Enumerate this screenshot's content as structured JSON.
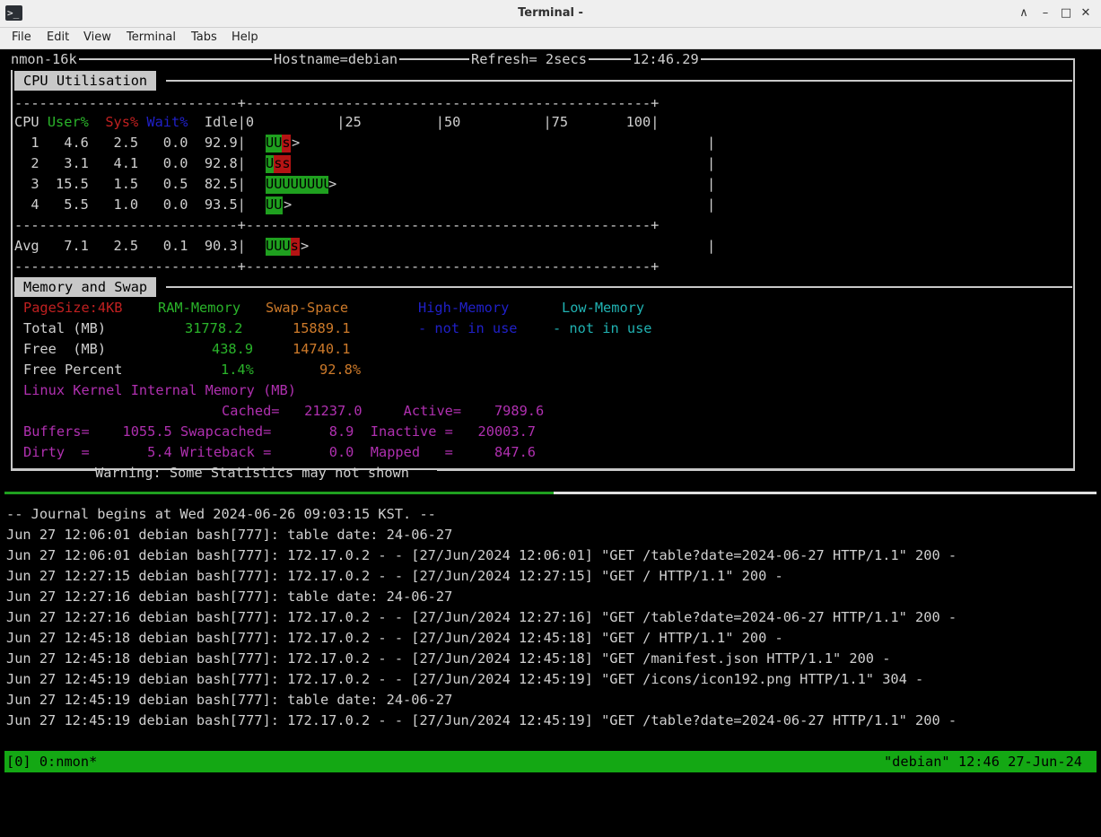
{
  "window": {
    "title": "Terminal -",
    "icon": "terminal-icon"
  },
  "menu": [
    "File",
    "Edit",
    "View",
    "Terminal",
    "Tabs",
    "Help"
  ],
  "nmon": {
    "header": {
      "name": "nmon-16k",
      "hostname": "Hostname=debian",
      "refresh": "Refresh= 2secs",
      "time": "12:46.29"
    },
    "cpu": {
      "section_title": "CPU Utilisation",
      "separator_top": "---------------------------+-------------------------------------------------+",
      "header_cpu": "CPU ",
      "header_user": "User%",
      "header_sys": "Sys%",
      "header_wait": "Wait%",
      "header_idle": "Idle",
      "scale": "|0          |25         |50          |75       100|",
      "rows": [
        {
          "line": "  1   4.6   2.5   0.0  92.9|",
          "bar": "UUs",
          "user": 4.6,
          "sys": 2.5
        },
        {
          "line": "  2   3.1   4.1   0.0  92.8|",
          "bar": "Uss",
          "user": 3.1,
          "sys": 4.1
        },
        {
          "line": "  3  15.5   1.5   0.5  82.5|",
          "bar": "UUUUUUUU",
          "user": 15.5,
          "sys": 1.5
        },
        {
          "line": "  4   5.5   1.0   0.0  93.5|",
          "bar": "UU",
          "user": 5.5,
          "sys": 1.0
        }
      ],
      "avg": {
        "line": "Avg   7.1   2.5   0.1  90.3|",
        "bar": "UUUs",
        "user": 7.1,
        "sys": 2.5
      },
      "bar_end": ">",
      "right_edge": "|"
    },
    "memory": {
      "section_title": "Memory and Swap",
      "pagesize": "PageSize:4KB",
      "ram_label": "RAM-Memory",
      "swap_label": "Swap-Space",
      "high_label": "High-Memory",
      "low_label": "Low-Memory",
      "total_label": "Total (MB)",
      "total_ram": "31778.2",
      "total_swap": "15889.1",
      "high_state": "- not in use",
      "low_state": "- not in use",
      "free_label": "Free  (MB)",
      "free_ram": "438.9",
      "free_swap": "14740.1",
      "freepct_label": "Free Percent",
      "freepct_ram": "1.4%",
      "freepct_swap": "92.8%",
      "kernel_title": "Linux Kernel Internal Memory (MB)",
      "kernel_line1": "                        Cached=   21237.0     Active=    7989.6",
      "kernel_line2": "Buffers=    1055.5 Swapcached=       8.9  Inactive =   20003.7",
      "kernel_line3": "Dirty  =       5.4 Writeback =       0.0  Mapped   =     847.6"
    },
    "warning": "Warning: Some Statistics may not shown"
  },
  "journal": [
    "-- Journal begins at Wed 2024-06-26 09:03:15 KST. --",
    "Jun 27 12:06:01 debian bash[777]: table date: 24-06-27",
    "Jun 27 12:06:01 debian bash[777]: 172.17.0.2 - - [27/Jun/2024 12:06:01] \"GET /table?date=2024-06-27 HTTP/1.1\" 200 -",
    "Jun 27 12:27:15 debian bash[777]: 172.17.0.2 - - [27/Jun/2024 12:27:15] \"GET / HTTP/1.1\" 200 -",
    "Jun 27 12:27:16 debian bash[777]: table date: 24-06-27",
    "Jun 27 12:27:16 debian bash[777]: 172.17.0.2 - - [27/Jun/2024 12:27:16] \"GET /table?date=2024-06-27 HTTP/1.1\" 200 -",
    "Jun 27 12:45:18 debian bash[777]: 172.17.0.2 - - [27/Jun/2024 12:45:18] \"GET / HTTP/1.1\" 200 -",
    "Jun 27 12:45:18 debian bash[777]: 172.17.0.2 - - [27/Jun/2024 12:45:18] \"GET /manifest.json HTTP/1.1\" 200 -",
    "Jun 27 12:45:19 debian bash[777]: 172.17.0.2 - - [27/Jun/2024 12:45:19] \"GET /icons/icon192.png HTTP/1.1\" 304 -",
    "Jun 27 12:45:19 debian bash[777]: table date: 24-06-27",
    "Jun 27 12:45:19 debian bash[777]: 172.17.0.2 - - [27/Jun/2024 12:45:19] \"GET /table?date=2024-06-27 HTTP/1.1\" 200 -"
  ],
  "status": {
    "left": "[0] 0:nmon*",
    "right": "\"debian\" 12:46 27-Jun-24"
  },
  "colors": {
    "green": "#1fa01f",
    "red": "#b41414",
    "statusbar": "#14a814"
  }
}
